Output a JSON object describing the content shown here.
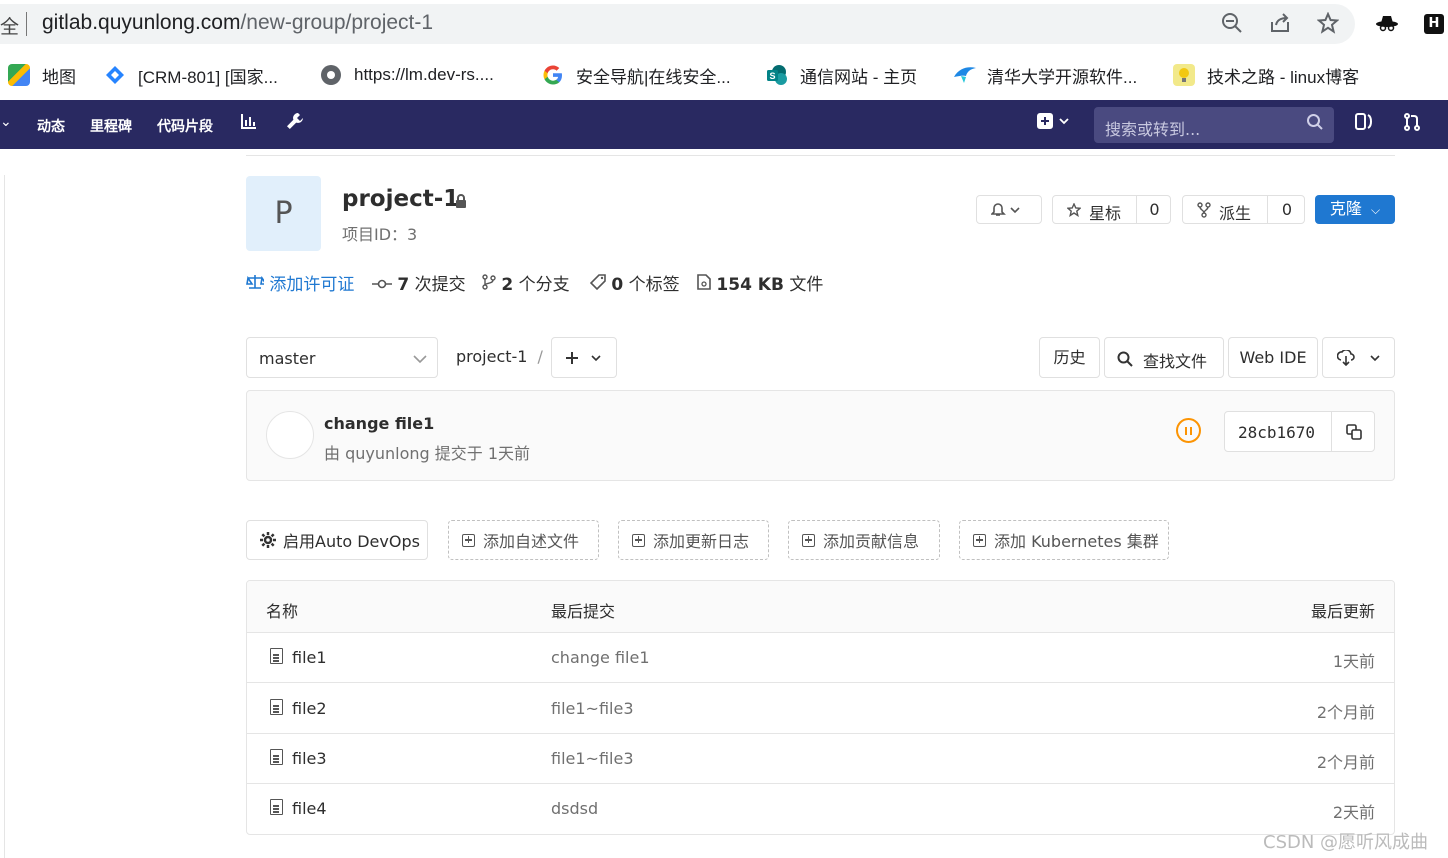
{
  "browser": {
    "security_label": "全",
    "url_host": "gitlab.quyunlong.com",
    "url_path": "/new-group/project-1"
  },
  "bookmarks": [
    {
      "label": "地图",
      "icon": "maps-icon",
      "color": "#34a853"
    },
    {
      "label": "[CRM-801] [国家...",
      "icon": "jira-icon",
      "color": "#2684ff"
    },
    {
      "label": "https://lm.dev-rs....",
      "icon": "globe-icon",
      "color": "#5f6368"
    },
    {
      "label": "安全导航|在线安全...",
      "icon": "google-icon",
      "color": "#ea4335"
    },
    {
      "label": "通信网站 - 主页",
      "icon": "sharepoint-icon",
      "color": "#038387"
    },
    {
      "label": "清华大学开源软件...",
      "icon": "tuna-icon",
      "color": "#1e88e5"
    },
    {
      "label": "技术之路 - linux博客",
      "icon": "bulb-icon",
      "color": "#f2c811"
    }
  ],
  "nav": {
    "items": [
      "动态",
      "里程碑",
      "代码片段"
    ],
    "search_placeholder": "搜索或转到..."
  },
  "project": {
    "avatar_letter": "P",
    "name": "project-1",
    "id_label": "项目ID：3",
    "star_label": "星标",
    "star_count": "0",
    "fork_label": "派生",
    "fork_count": "0",
    "clone_label": "克隆"
  },
  "stats": {
    "license": "添加许可证",
    "commits_num": "7",
    "commits_label": "次提交",
    "branches_num": "2",
    "branches_label": "个分支",
    "tags_num": "0",
    "tags_label": "个标签",
    "size_num": "154 KB",
    "size_label": "文件"
  },
  "repo": {
    "branch": "master",
    "path": "project-1",
    "separator": "/",
    "history": "历史",
    "find_file": "查找文件",
    "web_ide": "Web IDE"
  },
  "commit": {
    "message": "change file1",
    "author_line": "由 quyunlong 提交于 1天前",
    "sha": "28cb1670",
    "pipeline_color": "#fc9403"
  },
  "quick_actions": {
    "auto_devops": "启用Auto DevOps",
    "readme": "添加自述文件",
    "changelog": "添加更新日志",
    "contributing": "添加贡献信息",
    "kubernetes": "添加 Kubernetes 集群"
  },
  "table": {
    "headers": {
      "name": "名称",
      "last_commit": "最后提交",
      "last_update": "最后更新"
    },
    "rows": [
      {
        "name": "file1",
        "commit": "change file1",
        "updated": "1天前"
      },
      {
        "name": "file2",
        "commit": "file1~file3",
        "updated": "2个月前"
      },
      {
        "name": "file3",
        "commit": "file1~file3",
        "updated": "2个月前"
      },
      {
        "name": "file4",
        "commit": "dsdsd",
        "updated": "2天前"
      }
    ]
  },
  "watermark": "CSDN @愿听风成曲"
}
